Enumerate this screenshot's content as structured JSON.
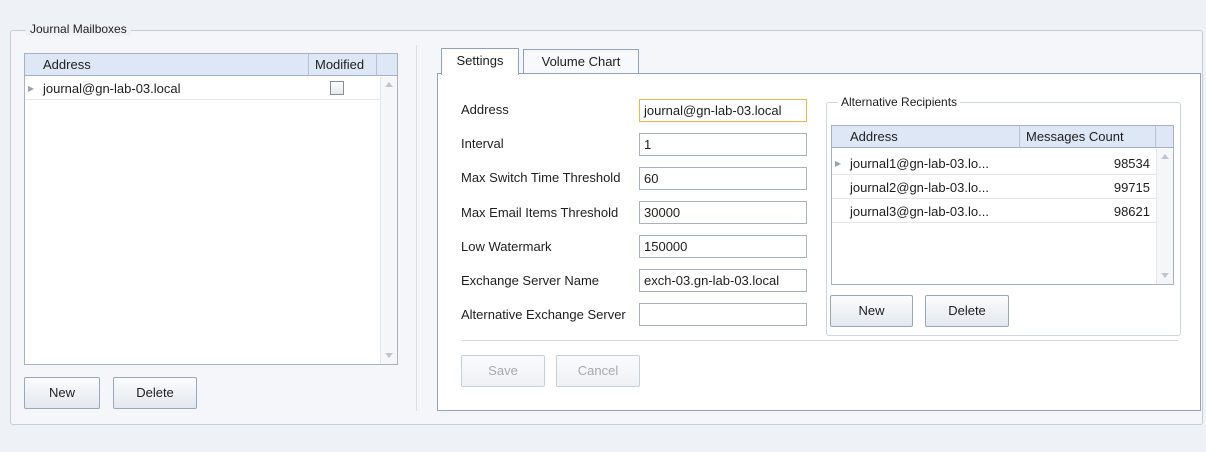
{
  "journal_mailboxes": {
    "legend": "Journal Mailboxes",
    "columns": [
      "Address",
      "Modified"
    ],
    "rows": [
      {
        "address": "journal@gn-lab-03.local",
        "modified": false
      }
    ],
    "new_label": "New",
    "delete_label": "Delete"
  },
  "tabs": [
    {
      "label": "Settings",
      "active": true
    },
    {
      "label": "Volume Chart",
      "active": false
    }
  ],
  "settings": {
    "fields": [
      {
        "label": "Address",
        "value": "journal@gn-lab-03.local"
      },
      {
        "label": "Interval",
        "value": "1"
      },
      {
        "label": "Max Switch Time Threshold",
        "value": "60"
      },
      {
        "label": "Max Email Items Threshold",
        "value": "30000"
      },
      {
        "label": "Low Watermark",
        "value": "150000"
      },
      {
        "label": "Exchange Server Name",
        "value": "exch-03.gn-lab-03.local"
      },
      {
        "label": "Alternative Exchange Server",
        "value": ""
      }
    ],
    "save_label": "Save",
    "cancel_label": "Cancel"
  },
  "alternative_recipients": {
    "legend": "Alternative Recipients",
    "columns": [
      "Address",
      "Messages Count"
    ],
    "rows": [
      {
        "address": "journal1@gn-lab-03.lo...",
        "count": "98534"
      },
      {
        "address": "journal2@gn-lab-03.lo...",
        "count": "99715"
      },
      {
        "address": "journal3@gn-lab-03.lo...",
        "count": "98621"
      }
    ],
    "new_label": "New",
    "delete_label": "Delete"
  }
}
